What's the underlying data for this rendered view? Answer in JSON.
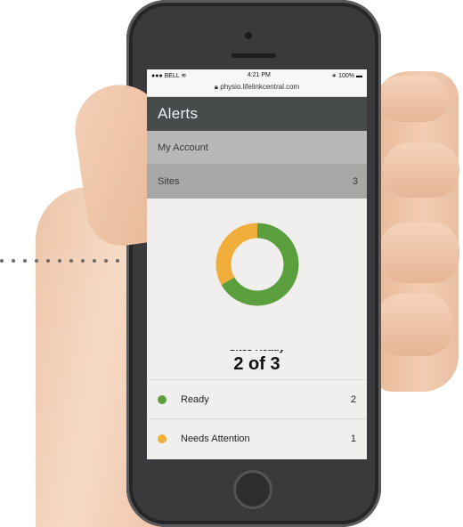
{
  "status_bar": {
    "carrier": "BELL",
    "time": "4:21 PM",
    "battery": "100%"
  },
  "browser": {
    "url": "physio.lifelinkcentral.com"
  },
  "header": {
    "title": "Alerts"
  },
  "menu": [
    {
      "label": "My Account",
      "value": ""
    },
    {
      "label": "Sites",
      "value": "3"
    }
  ],
  "summary": {
    "title": "Sites Ready",
    "value": "2 of 3"
  },
  "legend": [
    {
      "label": "Ready",
      "count": "2",
      "color": "#5a9e3e"
    },
    {
      "label": "Needs Attention",
      "count": "1",
      "color": "#f1ae3a"
    }
  ],
  "chart_data": {
    "type": "pie",
    "categories": [
      "Ready",
      "Needs Attention"
    ],
    "values": [
      2,
      1
    ],
    "colors": [
      "#5a9e3e",
      "#f1ae3a"
    ]
  }
}
